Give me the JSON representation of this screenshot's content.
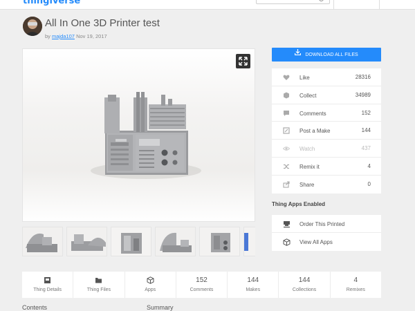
{
  "header": {
    "logo": "thingiverse",
    "search_placeholder": ""
  },
  "thing": {
    "title": "All In One 3D Printer test",
    "by_prefix": "by",
    "author": "majda107",
    "date": "Nov 19, 2017"
  },
  "viewer": {
    "image": "3d-printed-test-part-photo",
    "fullscreen_icon": "expand-icon",
    "thumbnails": [
      "thumbnail-1",
      "thumbnail-2",
      "thumbnail-3",
      "thumbnail-4",
      "thumbnail-5",
      "thumbnail-6"
    ]
  },
  "sidebar": {
    "download_label": "DOWNLOAD ALL FILES",
    "stats": [
      {
        "icon": "heart-icon",
        "label": "Like",
        "value": "28316"
      },
      {
        "icon": "collect-icon",
        "label": "Collect",
        "value": "34989"
      },
      {
        "icon": "comment-icon",
        "label": "Comments",
        "value": "152"
      },
      {
        "icon": "post-make-icon",
        "label": "Post a Make",
        "value": "144"
      },
      {
        "icon": "eye-icon",
        "label": "Watch",
        "value": "437"
      },
      {
        "icon": "remix-icon",
        "label": "Remix it",
        "value": "4"
      },
      {
        "icon": "share-icon",
        "label": "Share",
        "value": "0"
      }
    ],
    "apps_heading": "Thing Apps Enabled",
    "apps": [
      {
        "icon": "printer-icon",
        "label": "Order This Printed"
      },
      {
        "icon": "cube-icon",
        "label": "View All Apps"
      }
    ]
  },
  "tabs": [
    {
      "top": "",
      "icon": "details-icon",
      "label": "Thing Details"
    },
    {
      "top": "",
      "icon": "folder-icon",
      "label": "Thing Files"
    },
    {
      "top": "",
      "icon": "cube-icon",
      "label": "Apps"
    },
    {
      "top": "152",
      "icon": "",
      "label": "Comments"
    },
    {
      "top": "144",
      "icon": "",
      "label": "Makes"
    },
    {
      "top": "144",
      "icon": "",
      "label": "Collections"
    },
    {
      "top": "4",
      "icon": "",
      "label": "Remixes"
    }
  ],
  "sections": {
    "contents": "Contents",
    "summary": "Summary"
  },
  "colors": {
    "accent": "#248bfb",
    "background": "#efefef"
  }
}
